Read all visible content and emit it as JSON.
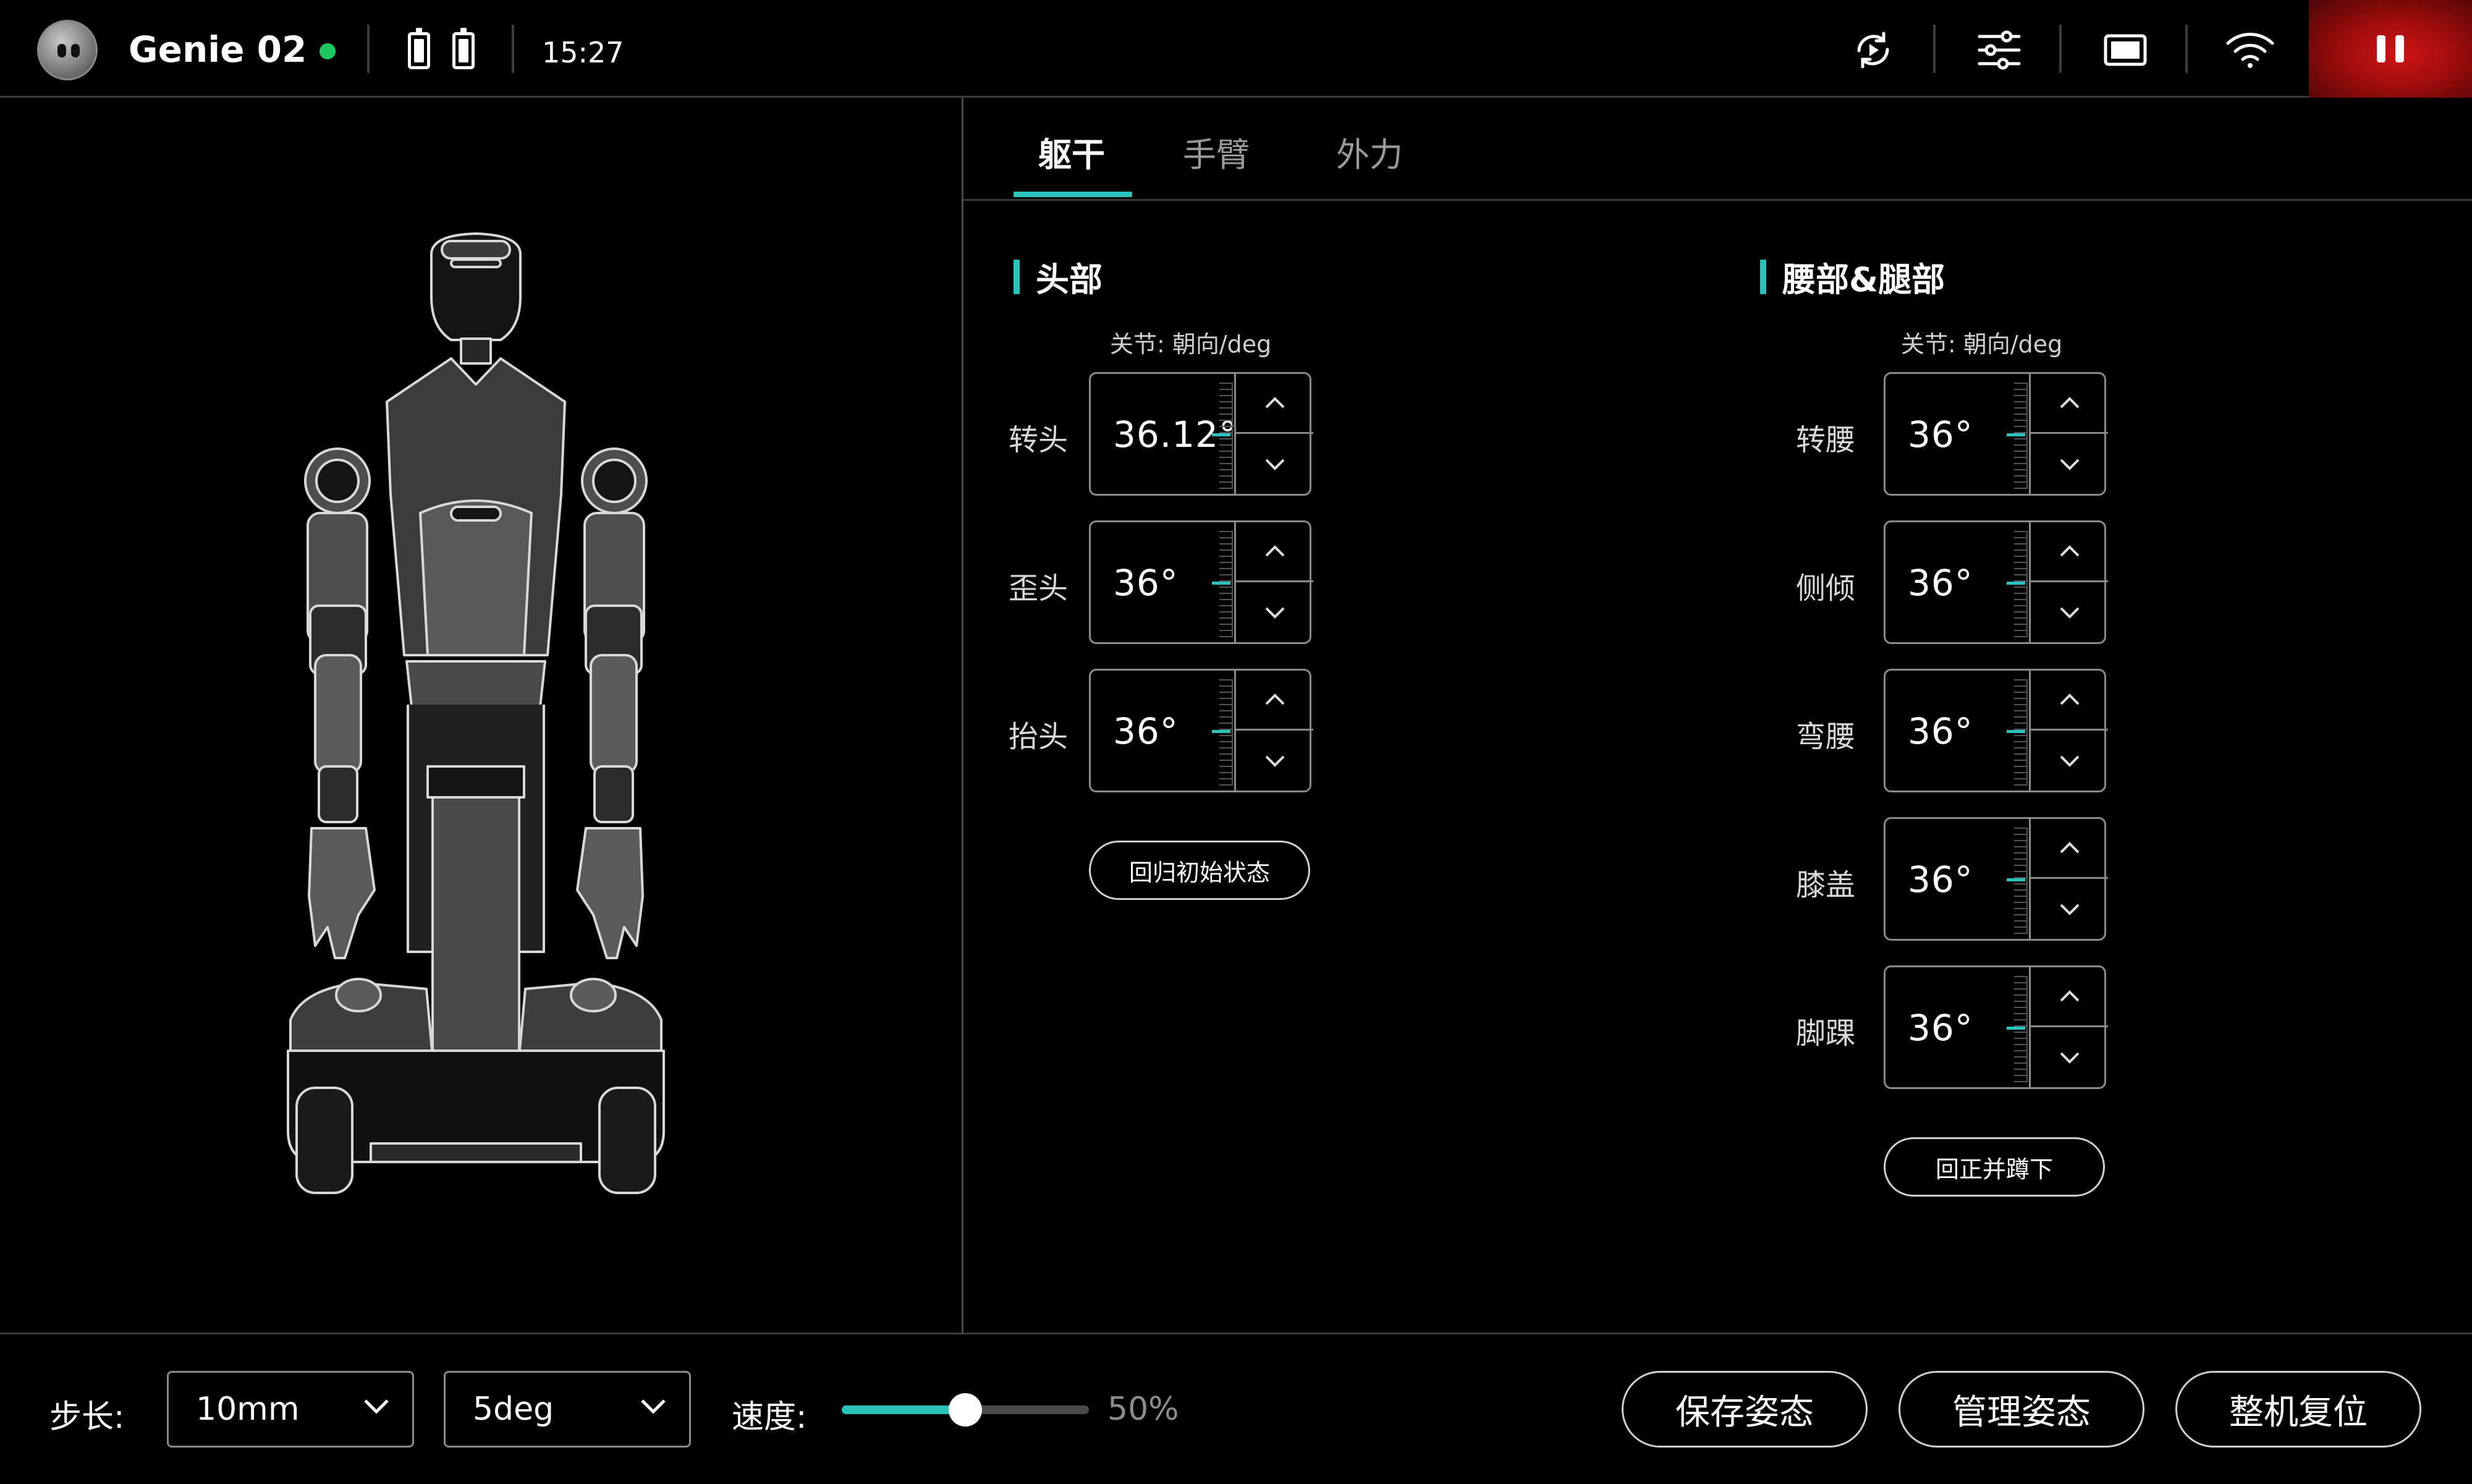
{
  "header": {
    "app_title": "Genie 02",
    "status_color": "#1ec95f",
    "clock": "15:27",
    "icons": [
      "battery-icon",
      "battery-icon",
      "refresh-play-icon",
      "sliders-icon",
      "screen-icon",
      "wifi-icon",
      "pause-icon"
    ]
  },
  "tabs": [
    {
      "label": "躯干",
      "active": true
    },
    {
      "label": "手臂",
      "active": false
    },
    {
      "label": "外力",
      "active": false
    }
  ],
  "head": {
    "title": "头部",
    "caption": "关节: 朝向/deg",
    "joints": [
      {
        "label": "转头",
        "value": "36.12°"
      },
      {
        "label": "歪头",
        "value": "36°"
      },
      {
        "label": "抬头",
        "value": "36°"
      }
    ],
    "reset_label": "回归初始状态"
  },
  "waist": {
    "title": "腰部&腿部",
    "caption": "关节: 朝向/deg",
    "joints": [
      {
        "label": "转腰",
        "value": "36°"
      },
      {
        "label": "侧倾",
        "value": "36°"
      },
      {
        "label": "弯腰",
        "value": "36°"
      },
      {
        "label": "膝盖",
        "value": "36°"
      },
      {
        "label": "脚踝",
        "value": "36°"
      }
    ],
    "squat_label": "回正并蹲下"
  },
  "bottom": {
    "step_label": "步长:",
    "step_mm": "10mm",
    "step_deg": "5deg",
    "speed_label": "速度:",
    "speed_value": 0.5,
    "speed_text": "50%",
    "save_label": "保存姿态",
    "manage_label": "管理姿态",
    "reset_all_label": "整机复位"
  },
  "accent_color": "#2bc3b9",
  "pause_color": "#c41212"
}
